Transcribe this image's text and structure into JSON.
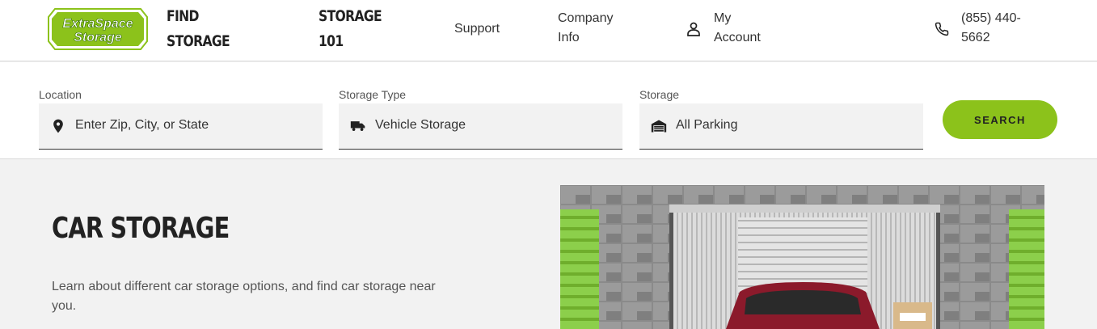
{
  "header": {
    "logo": {
      "line1": "ExtraSpace",
      "line2": "Storage",
      "color": "#8cc21b"
    },
    "nav": {
      "find_storage": {
        "line1": "FIND",
        "line2": "STORAGE"
      },
      "storage_101": {
        "line1": "STORAGE",
        "line2": "101"
      },
      "support": "Support",
      "company_info": {
        "line1": "Company",
        "line2": "Info"
      },
      "my_account": {
        "line1": "My",
        "line2": "Account",
        "icon": "user-icon"
      },
      "phone": {
        "line1": "(855) 440-",
        "line2": "5662",
        "icon": "phone-icon"
      }
    }
  },
  "search": {
    "location": {
      "label": "Location",
      "value": "Enter Zip, City, or State",
      "icon": "map-pin-icon"
    },
    "storage_type": {
      "label": "Storage Type",
      "value": "Vehicle Storage",
      "icon": "truck-icon"
    },
    "storage": {
      "label": "Storage",
      "value": "All Parking",
      "icon": "garage-icon"
    },
    "button_label": "SEARCH",
    "accent": "#8cc21b"
  },
  "hero": {
    "title": "CAR STORAGE",
    "description": "Learn about different car storage options, and find car storage near you.",
    "image": "storage-unit-with-red-car-photo"
  }
}
